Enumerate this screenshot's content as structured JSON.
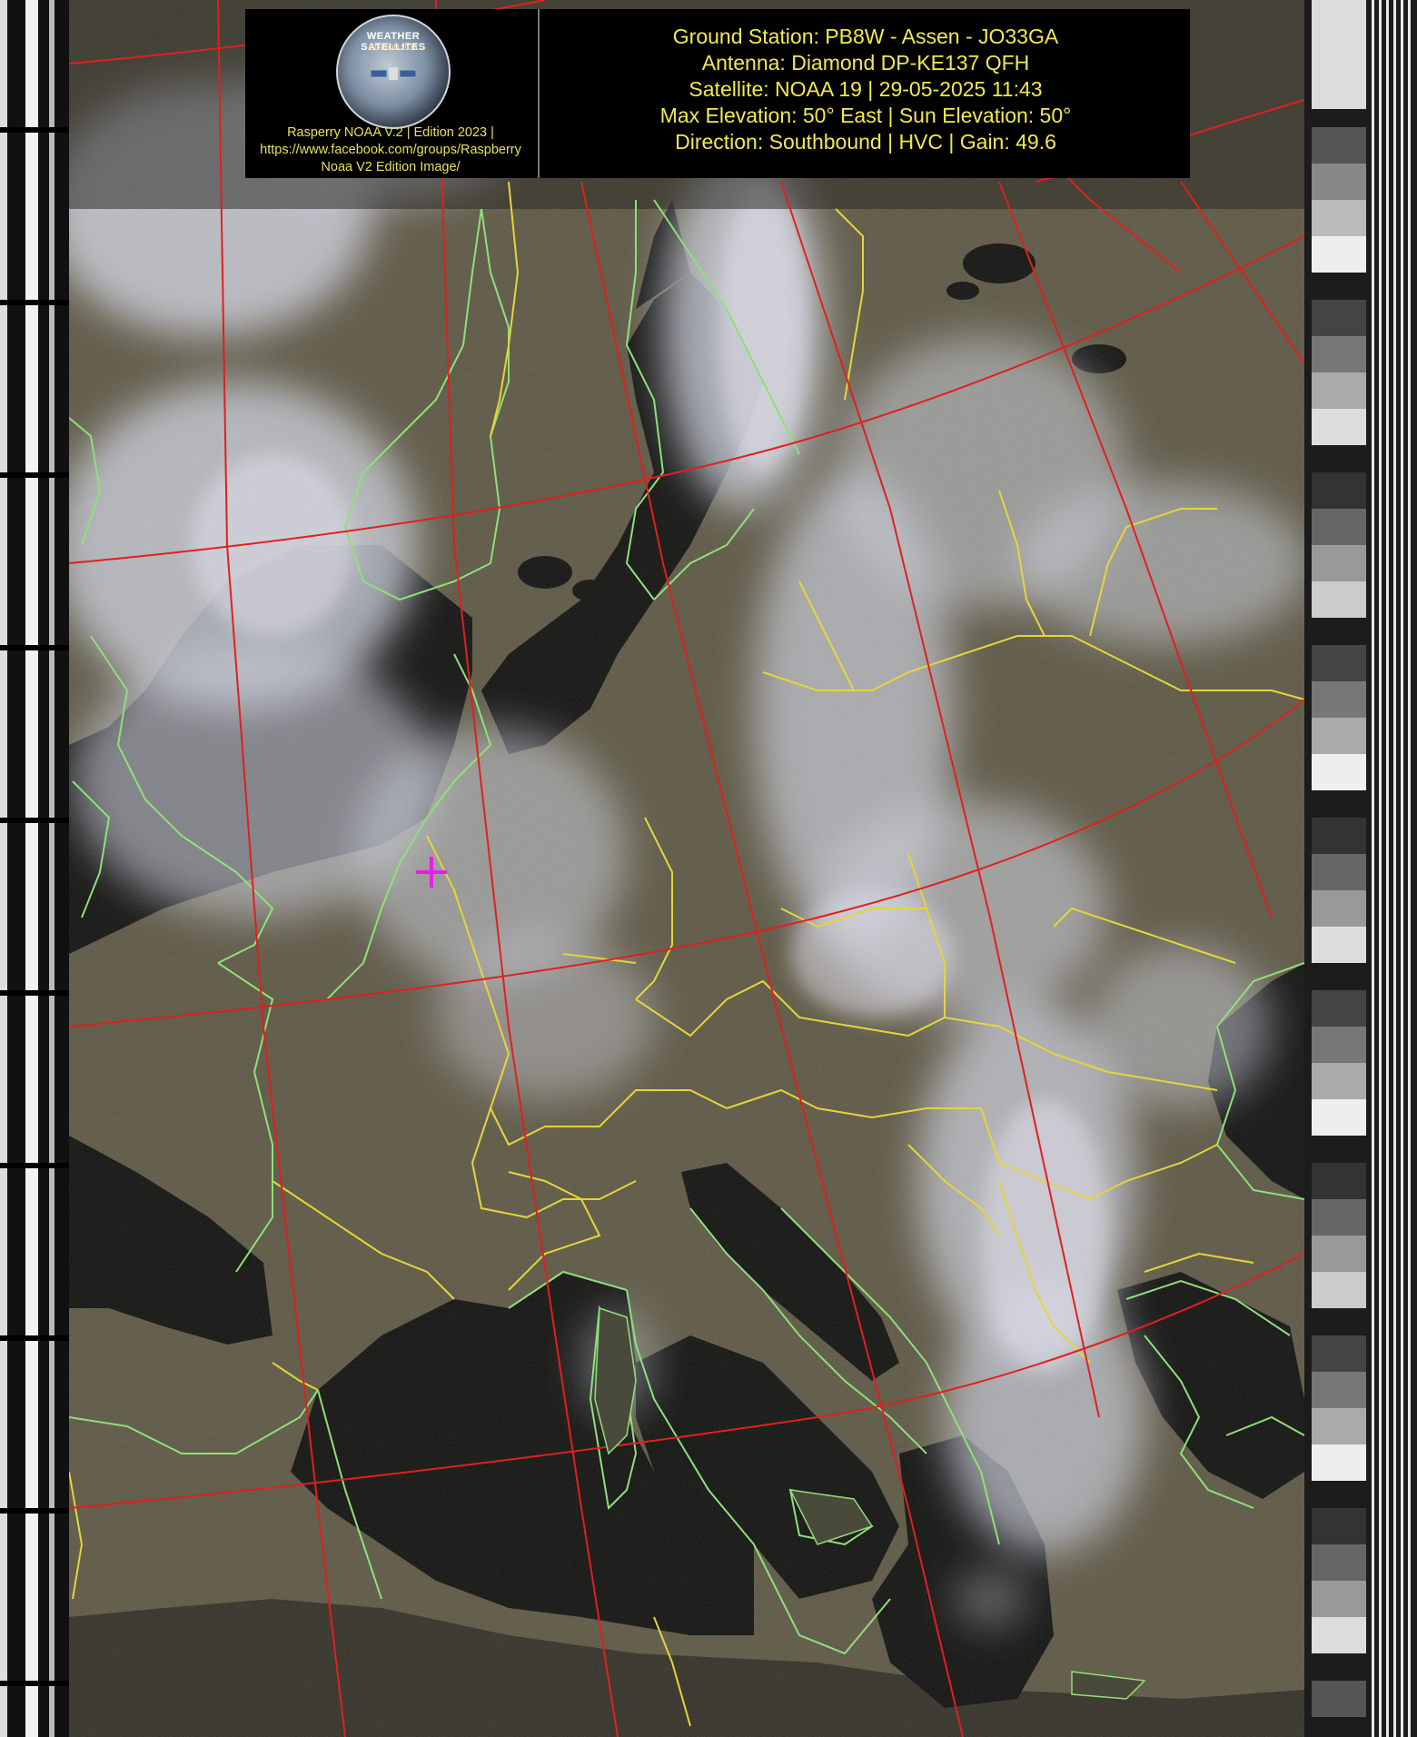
{
  "header": {
    "logo": {
      "badge_title": "WEATHER SATELLITES",
      "badge_edition": "EDITION 2023",
      "caption_lines": [
        "Rasperry NOAA V.2 | Edition 2023 |",
        "https://www.facebook.com/groups/Raspberry",
        "Noaa V2 Edition Image/"
      ]
    },
    "info_lines": [
      "Ground Station: PB8W - Assen - JO33GA",
      "Antenna: Diamond DP-KE137 QFH",
      "Satellite: NOAA 19 | 29-05-2025 11:43",
      "Max Elevation: 50° East | Sun Elevation: 50°",
      "Direction: Southbound | HVC | Gain: 49.6"
    ]
  },
  "colors": {
    "grid_lines": "#e0201f",
    "borders_country": "#e6d43a",
    "coastlines": "#8fe07a",
    "location_marker": "#e61fe6",
    "sea": "#0c0c0a",
    "land": "#5b5541",
    "cloud": "#c9ccd8",
    "header_text": "#f2e94e",
    "caption_text": "#e8e05a"
  },
  "map": {
    "marker_icon": "crosshair-icon"
  }
}
